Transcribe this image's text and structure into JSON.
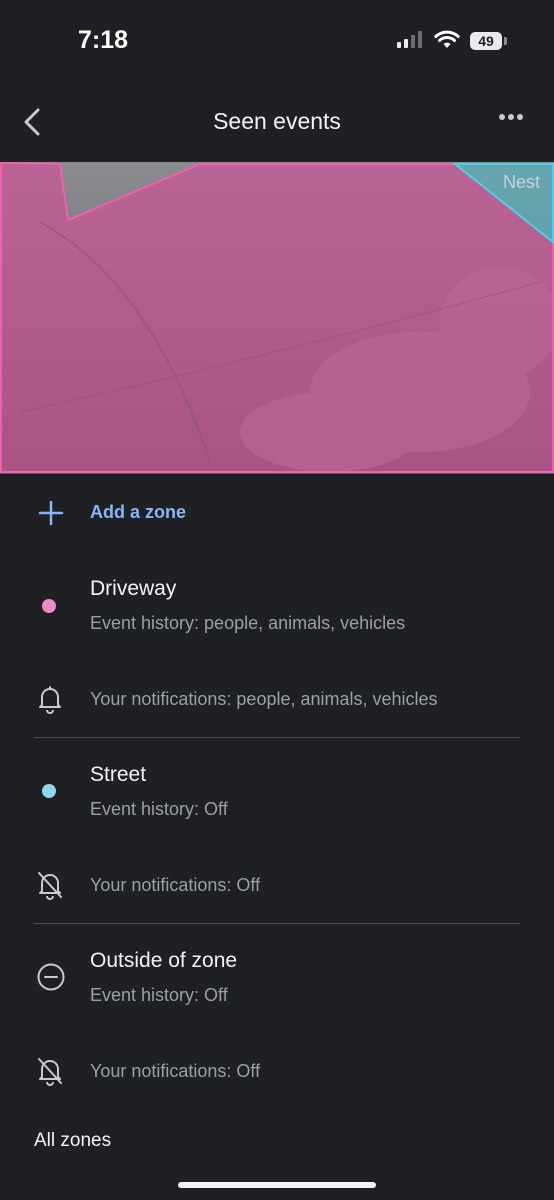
{
  "status": {
    "time": "7:18",
    "battery": "49"
  },
  "header": {
    "title": "Seen events"
  },
  "camera": {
    "label": "Nest",
    "zone_colors": {
      "driveway": "#d94c9a",
      "street": "#3ec5d8"
    }
  },
  "add_zone": {
    "label": "Add a zone"
  },
  "zones": [
    {
      "name": "Driveway",
      "history": "Event history: people, animals, vehicles",
      "notifications": "Your notifications: people, animals, vehicles",
      "color": "#f08bc8"
    },
    {
      "name": "Street",
      "history": "Event history: Off",
      "notifications": "Your notifications: Off",
      "color": "#8fd8ec"
    },
    {
      "name": "Outside of zone",
      "history": "Event history: Off",
      "notifications": "Your notifications: Off"
    }
  ],
  "footer": {
    "all_zones": "All zones"
  }
}
